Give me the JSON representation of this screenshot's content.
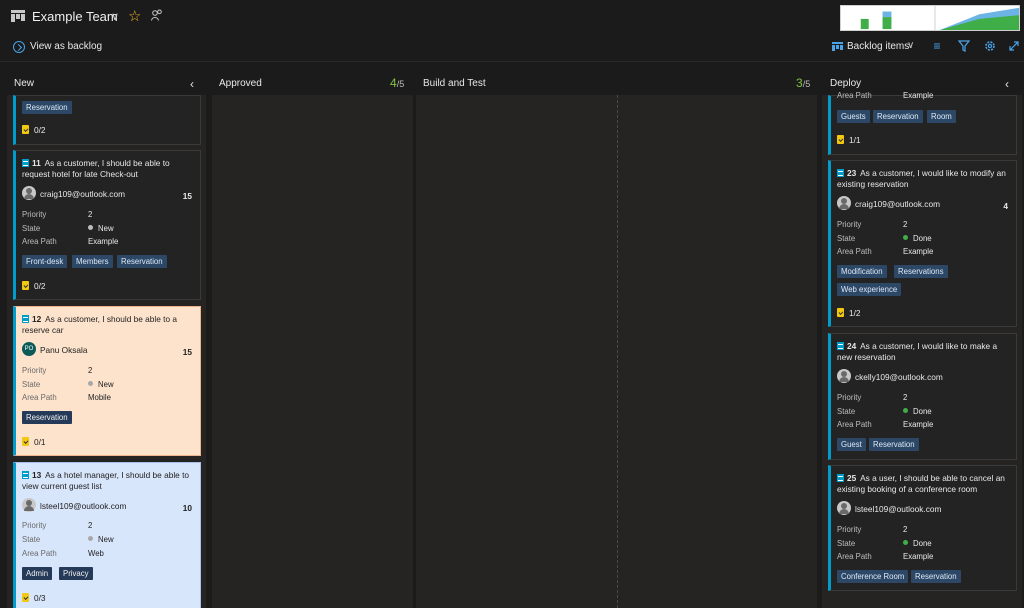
{
  "header": {
    "team_name": "Example Team",
    "view_as_backlog": "View as backlog",
    "backlog_selector": "Backlog items"
  },
  "colors": {
    "accent": "#009ccc",
    "count_green": "#83c341",
    "new_dot": "#bdbdbd",
    "done_dot": "#3fae49"
  },
  "columns": {
    "new": {
      "title": "New"
    },
    "approved": {
      "title": "Approved",
      "count": "4",
      "limit": "/5"
    },
    "build": {
      "title": "Build and Test",
      "count": "3",
      "limit": "/5"
    },
    "deploy": {
      "title": "Deploy"
    }
  },
  "labels": {
    "priority": "Priority",
    "state": "State",
    "area": "Area Path"
  },
  "cards": {
    "c0": {
      "tags": [
        "Reservation"
      ],
      "tasks": "0/2"
    },
    "c11": {
      "id": "11",
      "title": "As a customer, I should be able to request hotel for late Check-out",
      "assignee": "craig109@outlook.com",
      "points": "15",
      "priority": "2",
      "state": "New",
      "area": "Example",
      "tags": [
        "Front-desk",
        "Members",
        "Reservation"
      ],
      "tasks": "0/2"
    },
    "c12": {
      "id": "12",
      "title": "As a customer, I should be able to a reserve car",
      "assignee": "Panu Oksala",
      "initials": "PO",
      "points": "15",
      "priority": "2",
      "state": "New",
      "area": "Mobile",
      "tags": [
        "Reservation"
      ],
      "tasks": "0/1"
    },
    "c13": {
      "id": "13",
      "title": "As a hotel manager, I should be able to view current guest list",
      "assignee": "lsteel109@outlook.com",
      "points": "10",
      "priority": "2",
      "state": "New",
      "area": "Web",
      "tags": [
        "Admin",
        "Privacy"
      ],
      "tasks": "0/3"
    },
    "d0": {
      "area_label": "Area Path",
      "area": "Example",
      "tags": [
        "Guests",
        "Reservation",
        "Room"
      ],
      "tasks": "1/1"
    },
    "c23": {
      "id": "23",
      "title": "As a customer, I would like to modify an existing reservation",
      "assignee": "craig109@outlook.com",
      "points": "4",
      "priority": "2",
      "state": "Done",
      "area": "Example",
      "tags": [
        "Modification",
        "Reservations",
        "Web experience"
      ],
      "tasks": "1/2"
    },
    "c24": {
      "id": "24",
      "title": "As a customer, I would like to make a new reservation",
      "assignee": "ckelly109@outlook.com",
      "priority": "2",
      "state": "Done",
      "area": "Example",
      "tags": [
        "Guest",
        "Reservation"
      ]
    },
    "c25": {
      "id": "25",
      "title": "As a user, I should be able to cancel an existing booking of a conference room",
      "assignee": "lsteel109@outlook.com",
      "priority": "2",
      "state": "Done",
      "area": "Example",
      "tags": [
        "Conference Room",
        "Reservation"
      ]
    }
  }
}
